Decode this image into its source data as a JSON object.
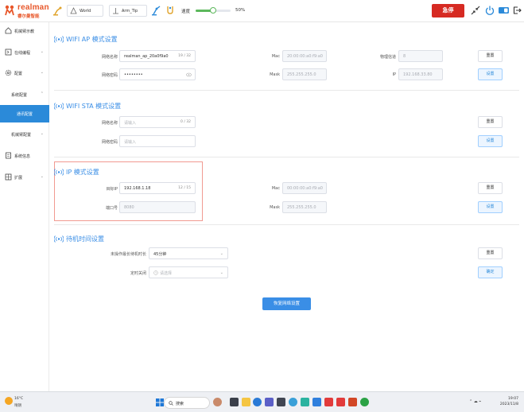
{
  "app": {
    "logo_text": "realman",
    "logo_subtext": "睿尔曼智能"
  },
  "topbar": {
    "coord_select": "World",
    "tool_select": "Arm_Tip",
    "speed_label": "速度",
    "speed_value": "50%",
    "speed_fraction": 0.5,
    "estop_label": "急停"
  },
  "sidebar": {
    "items": [
      {
        "label": "机械臂示教"
      },
      {
        "label": "在线编程"
      },
      {
        "label": "配置"
      },
      {
        "label": "系统配置"
      },
      {
        "label": "通讯配置"
      },
      {
        "label": "机械臂配置"
      },
      {
        "label": "系统信息"
      },
      {
        "label": "扩展"
      }
    ]
  },
  "wifi_ap": {
    "title": "WIFI AP 模式设置",
    "name_label": "网络名称",
    "name_value": "realman_ap_20a0f9a0",
    "name_count": "19 / 32",
    "password_label": "网络密码",
    "password_value": "••••••••",
    "mac_label": "Mac",
    "mac_value": "20:00:00:a0:f9:a0",
    "mask_label": "Mask",
    "mask_value": "255.255.255.0",
    "channel_label": "物理信道",
    "channel_value": "8",
    "ip_label": "IP",
    "ip_value": "192.168.33.80",
    "reset_label": "重置",
    "set_label": "设置"
  },
  "wifi_sta": {
    "title": "WIFI STA 模式设置",
    "name_label": "网络名称",
    "name_placeholder": "请输入",
    "name_count": "0 / 32",
    "password_label": "网络密码",
    "password_placeholder": "请输入",
    "reset_label": "重置",
    "set_label": "设置"
  },
  "ip_mode": {
    "title": "IP 模式设置",
    "ip_label": "目标IP",
    "ip_value": "192.168.1.18",
    "ip_count": "12 / 15",
    "port_label": "端口号",
    "port_value": "8080",
    "mac_label": "Mac",
    "mac_value": "00:00:00:a0:f9:a0",
    "mask_label": "Mask",
    "mask_value": "255.255.255.0",
    "reset_label": "重置",
    "set_label": "设置"
  },
  "standby": {
    "title": "待机时间设置",
    "idle_label": "未操作最长待机时长",
    "idle_value": "45分钟",
    "timer_label": "定时关闭",
    "timer_placeholder": "请选择",
    "reset_label": "重置",
    "confirm_label": "确定"
  },
  "save_button": "恢复网络设置",
  "taskbar": {
    "weather_temp": "16°C",
    "weather_desc": "晴朗",
    "search_label": "搜索",
    "time": "19:07",
    "date": "2023/11/8"
  }
}
